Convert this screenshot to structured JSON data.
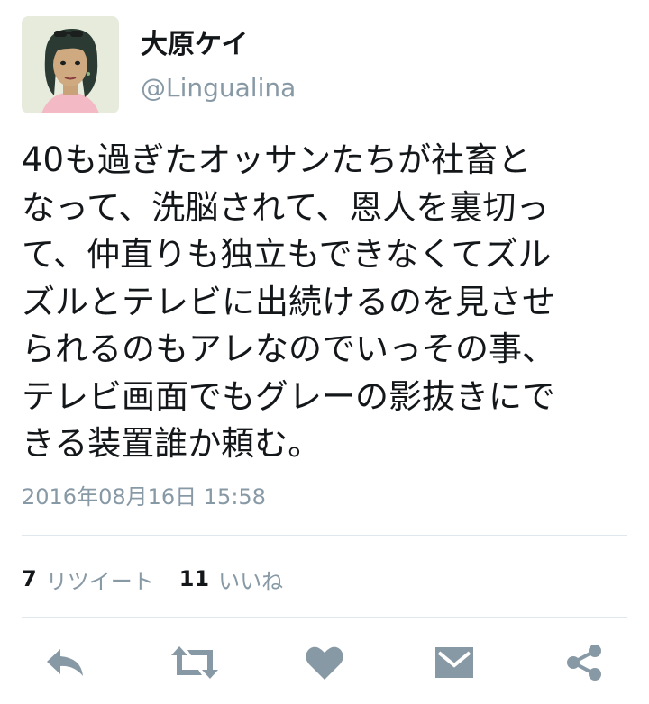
{
  "user": {
    "display_name": "大原ケイ",
    "handle": "@Lingualina"
  },
  "tweet": {
    "lines": [
      "40も過ぎたオッサンたちが社畜と",
      "なって、洗脳されて、恩人を裏切っ",
      "て、仲直りも独立もできなくてズル",
      "ズルとテレビに出続けるのを見させ",
      "られるのもアレなのでいっその事、",
      "テレビ画面でもグレーの影抜きにで",
      "きる装置誰か頼む。"
    ],
    "timestamp": "2016年08月16日 15:58"
  },
  "stats": {
    "retweets_count": "7",
    "retweets_label": "リツイート",
    "likes_count": "11",
    "likes_label": "いいね"
  },
  "actions": {
    "icons": [
      "reply-icon",
      "retweet-icon",
      "like-icon",
      "message-icon",
      "share-icon"
    ],
    "color": "#8899a6"
  }
}
